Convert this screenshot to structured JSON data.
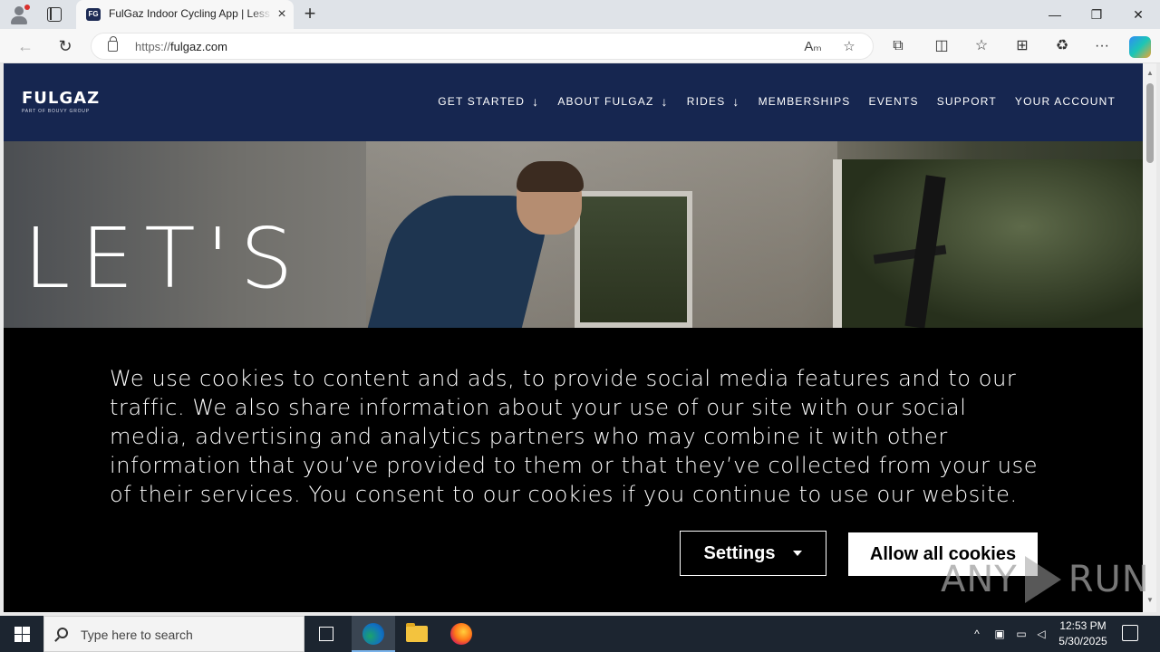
{
  "browser": {
    "tab_title": "FulGaz Indoor Cycling App | Less",
    "tab_favicon": "FG",
    "new_tab": "+",
    "url_scheme": "https://",
    "url_host": "fulgaz.com",
    "window_controls": {
      "minimize": "—",
      "restore": "❐",
      "close": "✕"
    },
    "nav": {
      "back": "←",
      "refresh": "↻"
    },
    "omnibox_icons": {
      "read_aloud": "Aₘ",
      "favorite": "☆"
    },
    "toolbar": {
      "extensions": "⧉",
      "split": "◫",
      "favorites": "☆",
      "collections": "⊞",
      "performance": "♻",
      "more": "···"
    }
  },
  "site": {
    "logo": {
      "word": "FULGAZ",
      "tagline": "PART OF BOUVY GROUP"
    },
    "nav": [
      {
        "label": "GET STARTED",
        "arrow": "↓"
      },
      {
        "label": "ABOUT FULGAZ",
        "arrow": "↓"
      },
      {
        "label": "RIDES",
        "arrow": "↓"
      },
      {
        "label": "MEMBERSHIPS"
      },
      {
        "label": "EVENTS"
      },
      {
        "label": "SUPPORT"
      },
      {
        "label": "YOUR ACCOUNT"
      }
    ],
    "hero_text": "LET'S"
  },
  "cookie_banner": {
    "text": "We use cookies to content and ads, to provide social media features and to our traffic. We also share information about your use of our site with our social media, advertising and analytics partners who may combine it with other information that you’ve provided to them or that they’ve collected from your use of their services. You consent to our cookies if you continue to use our website.",
    "settings_label": "Settings",
    "allow_label": "Allow all cookies"
  },
  "watermark": {
    "left": "ANY",
    "right": "RUN"
  },
  "taskbar": {
    "search_placeholder": "Type here to search",
    "tray_chevron": "^",
    "clock_time": "12:53 PM",
    "clock_date": "5/30/2025"
  },
  "colors": {
    "site_header": "#162650",
    "cookie_bg": "#000000",
    "taskbar": "#1c2530"
  }
}
